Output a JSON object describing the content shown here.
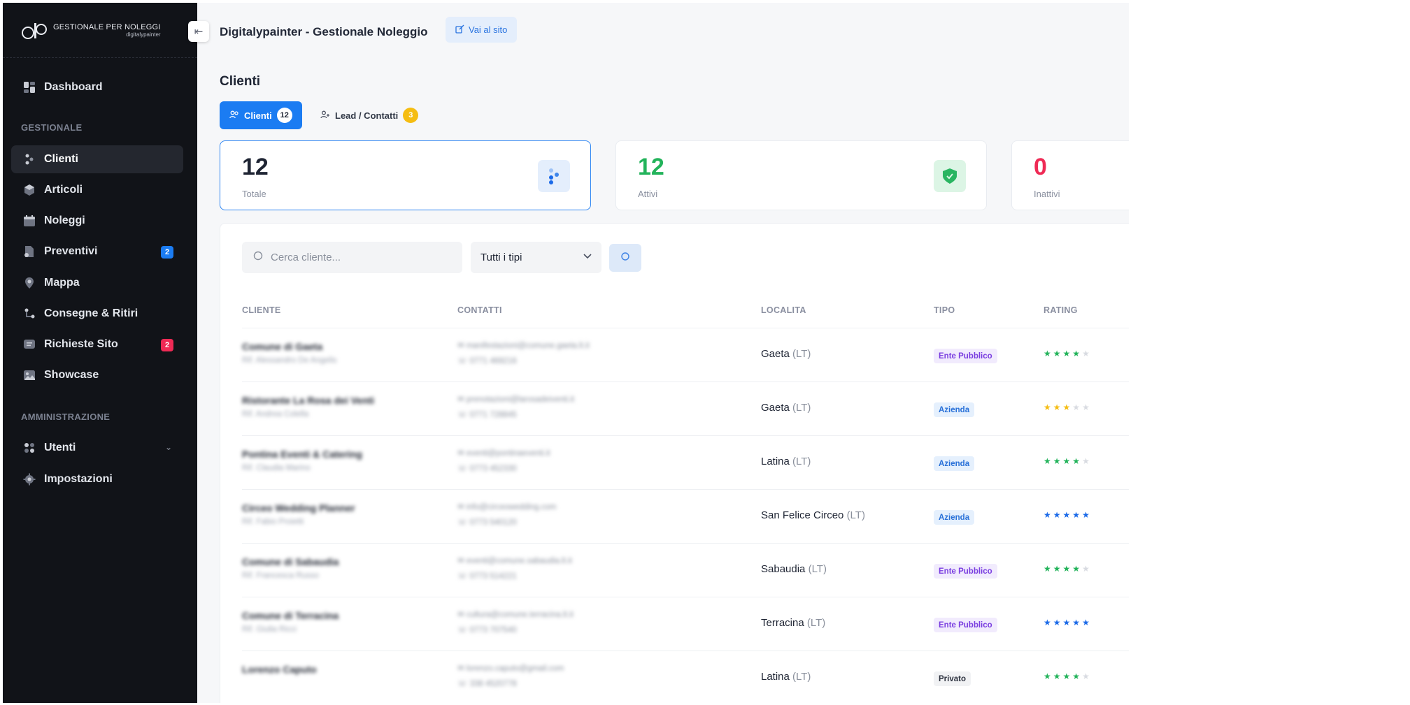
{
  "sidebar": {
    "logo": {
      "line1": "GESTIONALE PER NOLEGGI",
      "line2": "digitalypainter"
    },
    "items": [
      {
        "label": "Dashboard"
      },
      {
        "label": "Clienti"
      },
      {
        "label": "Articoli"
      },
      {
        "label": "Noleggi"
      },
      {
        "label": "Preventivi",
        "badge": "2"
      },
      {
        "label": "Mappa"
      },
      {
        "label": "Consegne & Ritiri"
      },
      {
        "label": "Richieste Sito",
        "badge": "2"
      },
      {
        "label": "Showcase"
      },
      {
        "label": "Utenti"
      },
      {
        "label": "Impostazioni"
      }
    ],
    "sections": {
      "gestionale": "GESTIONALE",
      "amministrazione": "AMMINISTRAZIONE"
    },
    "active": "Clienti"
  },
  "header": {
    "app_title": "Digitalypainter - Gestionale Noleggio",
    "site_button": "Vai al sito"
  },
  "page": {
    "title": "Clienti",
    "tabs": [
      {
        "label": "Clienti",
        "count": "12",
        "active": true
      },
      {
        "label": "Lead / Contatti",
        "count": "3",
        "active": false
      }
    ]
  },
  "stats": [
    {
      "value": "12",
      "label": "Totale",
      "color": "#1e2433"
    },
    {
      "value": "12",
      "label": "Attivi",
      "color": "#22b35a"
    },
    {
      "value": "0",
      "label": "Inattivi",
      "color": "#ef2a55"
    }
  ],
  "filters": {
    "search_placeholder": "Cerca cliente...",
    "type_select": "Tutti i tipi"
  },
  "table": {
    "columns": [
      "CLIENTE",
      "CONTATTI",
      "LOCALITA",
      "TIPO",
      "RATING"
    ],
    "rows": [
      {
        "name": "Comune di Gaeta",
        "ref": "Rif. Alessandro De Angelis",
        "email": "manifestazioni@comune.gaeta.lt.it",
        "phone": "0771 469216",
        "city": "Gaeta",
        "prov": "(LT)",
        "type": "Ente Pubblico",
        "rating": 4,
        "star_color": "#22b35a"
      },
      {
        "name": "Ristorante La Rosa dei Venti",
        "ref": "Rif. Andrea Colella",
        "email": "prenotazioni@larosadeiventi.it",
        "phone": "0771 728845",
        "city": "Gaeta",
        "prov": "(LT)",
        "type": "Azienda",
        "rating": 3,
        "star_color": "#f5bd12"
      },
      {
        "name": "Pontina Eventi & Catering",
        "ref": "Rif. Claudia Marino",
        "email": "eventi@pontinaeventi.it",
        "phone": "0773 452330",
        "city": "Latina",
        "prov": "(LT)",
        "type": "Azienda",
        "rating": 4,
        "star_color": "#22b35a"
      },
      {
        "name": "Circeo Wedding Planner",
        "ref": "Rif. Fabio Proietti",
        "email": "info@circeowedding.com",
        "phone": "0773 540120",
        "city": "San Felice Circeo",
        "prov": "(LT)",
        "type": "Azienda",
        "rating": 5,
        "star_color": "#1b6ae8"
      },
      {
        "name": "Comune di Sabaudia",
        "ref": "Rif. Francesca Russo",
        "email": "eventi@comune.sabaudia.lt.it",
        "phone": "0773 514221",
        "city": "Sabaudia",
        "prov": "(LT)",
        "type": "Ente Pubblico",
        "rating": 4,
        "star_color": "#22b35a"
      },
      {
        "name": "Comune di Terracina",
        "ref": "Rif. Giulia Ricci",
        "email": "cultura@comune.terracina.lt.it",
        "phone": "0773 707540",
        "city": "Terracina",
        "prov": "(LT)",
        "type": "Ente Pubblico",
        "rating": 5,
        "star_color": "#1b6ae8"
      },
      {
        "name": "Lorenzo Caputo",
        "ref": "",
        "email": "lorenzo.caputo@gmail.com",
        "phone": "338 4520778",
        "city": "Latina",
        "prov": "(LT)",
        "type": "Privato",
        "rating": 4,
        "star_color": "#22b35a"
      }
    ]
  }
}
